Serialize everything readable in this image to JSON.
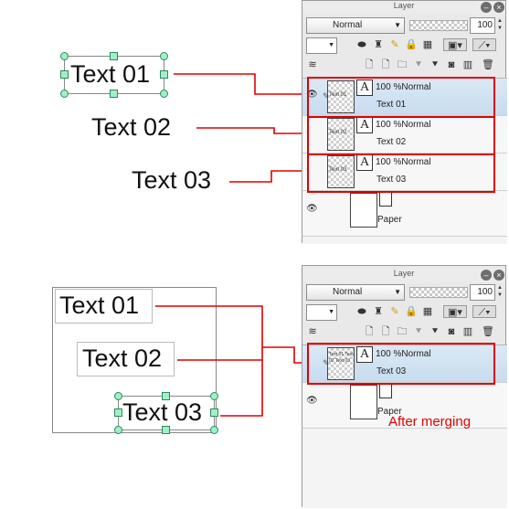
{
  "top_example": {
    "canvas_labels": [
      "Text 01",
      "Text 02",
      "Text 03"
    ],
    "panel": {
      "title": "Layer",
      "blend_mode": "Normal",
      "opacity": "100",
      "layers": [
        {
          "thumb_text": "Text 01",
          "props": "100 %Normal",
          "name": "Text 01",
          "selected": true
        },
        {
          "thumb_text": "Text 02",
          "props": "100 %Normal",
          "name": "Text 02",
          "selected": false
        },
        {
          "thumb_text": "Text 03",
          "props": "100 %Normal",
          "name": "Text 03",
          "selected": false
        },
        {
          "thumb_text": "",
          "props": "",
          "name": "Paper",
          "selected": false
        }
      ]
    }
  },
  "bottom_example": {
    "canvas_labels": [
      "Text 01",
      "Text 02",
      "Text 03"
    ],
    "panel": {
      "title": "Layer",
      "blend_mode": "Normal",
      "opacity": "100",
      "layers": [
        {
          "thumb_text": "Text 01 Text 02 Text 03",
          "props": "100 %Normal",
          "name": "Text 03",
          "selected": true
        },
        {
          "thumb_text": "",
          "props": "",
          "name": "Paper",
          "selected": false
        }
      ]
    },
    "caption": "After merging"
  },
  "icons": {
    "close": "close-icon",
    "minimize": "minimize-icon",
    "eye": "eye-icon",
    "pen": "pen-icon",
    "text_layer": "text-layer-icon",
    "paper_layer": "paper-layer-icon"
  },
  "colors": {
    "annotation": "#e00000",
    "handle_fill": "#9ff0c8",
    "selected_row": "#c7dcee"
  }
}
